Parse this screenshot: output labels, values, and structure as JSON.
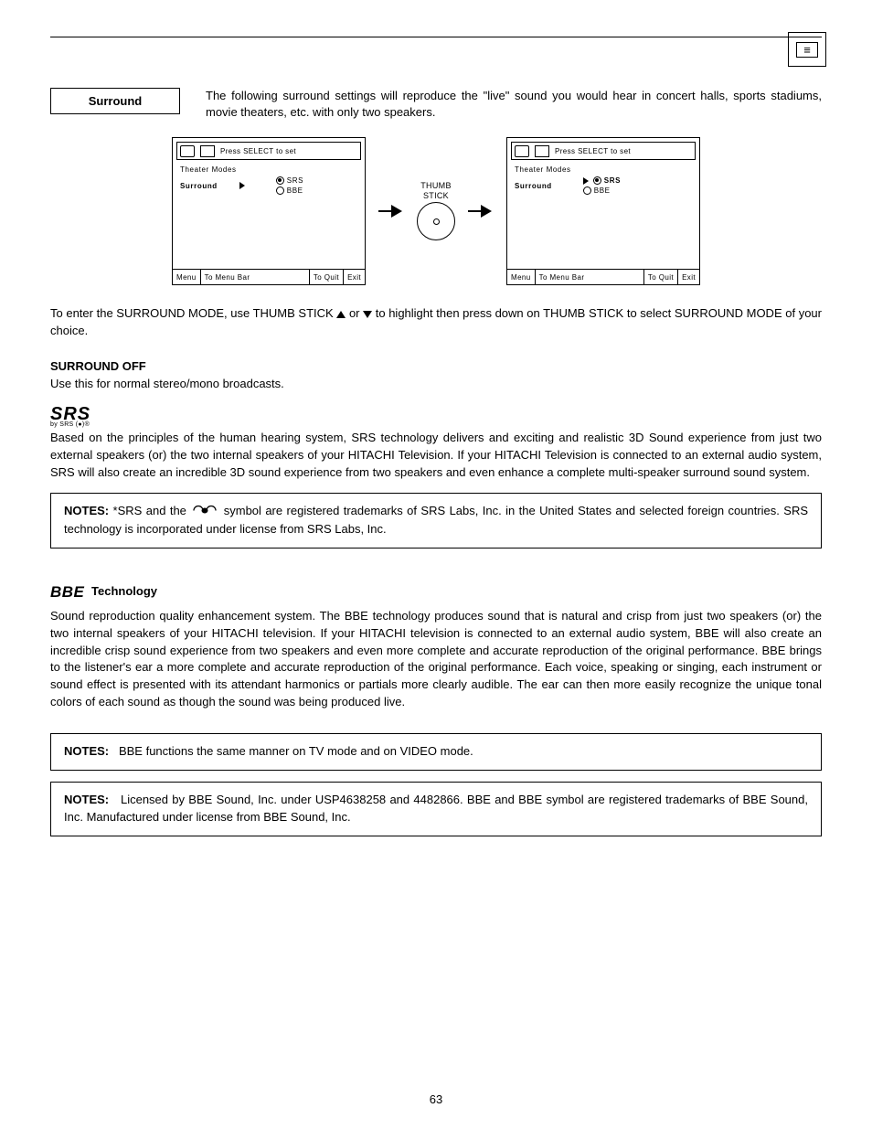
{
  "header": {
    "section_label": "Surround",
    "intro": "The following surround settings will reproduce the \"live\" sound you would hear in concert halls, sports stadiums, movie theaters, etc. with only two speakers."
  },
  "osd": {
    "top_label": "Press SELECT to set",
    "body_line1": "Theater Modes",
    "body_surround": "Surround",
    "opt_srs": "SRS",
    "opt_bbe": "BBE",
    "bottom_menu": "Menu",
    "bottom_to_menu": "To Menu Bar",
    "bottom_to_quit": "To Quit",
    "bottom_exit": "Exit"
  },
  "thumbstick": {
    "l1": "THUMB",
    "l2": "STICK"
  },
  "body": {
    "enter_mode_a": "To enter the SURROUND MODE, use THUMB STICK ",
    "enter_mode_b": " or ",
    "enter_mode_c": " to highlight then press down on THUMB STICK to select SURROUND MODE of your choice.",
    "surround_off_h": "SURROUND OFF",
    "surround_off_p": "Use this for normal stereo/mono broadcasts.",
    "srs_big": "SRS",
    "srs_small": "by SRS (●)®",
    "srs_p": "Based on the principles of the human hearing system, SRS technology delivers and exciting and realistic 3D Sound experience from just two external speakers (or) the two internal speakers of your HITACHI Television.  If your HITACHI Television is connected to an external audio system, SRS will also create an incredible 3D sound experience from two speakers and even enhance a complete multi-speaker surround sound system.",
    "notes_label": "NOTES:",
    "srs_note_a": " *SRS and the ",
    "srs_note_b": " symbol are registered trademarks of SRS Labs, Inc. in the United States and selected foreign countries. SRS technology is incorporated under license from SRS Labs, Inc.",
    "bbe_logo": "BBE",
    "bbe_tech": " Technology",
    "bbe_p": "Sound reproduction quality enhancement system.  The BBE technology produces sound that is natural and crisp from just two speakers (or) the two internal speakers of your HITACHI television. If your HITACHI television is connected to an external audio system, BBE will also create an incredible crisp sound experience from two speakers and even more complete and accurate reproduction of the original performance.  BBE brings to the listener's ear a more complete and accurate reproduction of the original performance.  Each voice, speaking or singing, each instrument or sound effect is presented with its attendant harmonics or partials more clearly audible.  The ear can then more easily recognize the unique tonal colors of each sound as though the sound was being produced live.",
    "bbe_note1": "BBE functions the same manner on TV mode and on VIDEO mode.",
    "bbe_note2": "Licensed by BBE Sound, Inc. under USP4638258 and 4482866.  BBE and BBE symbol are registered trademarks of BBE Sound, Inc.  Manufactured under license from BBE Sound, Inc."
  },
  "page_number": "63"
}
